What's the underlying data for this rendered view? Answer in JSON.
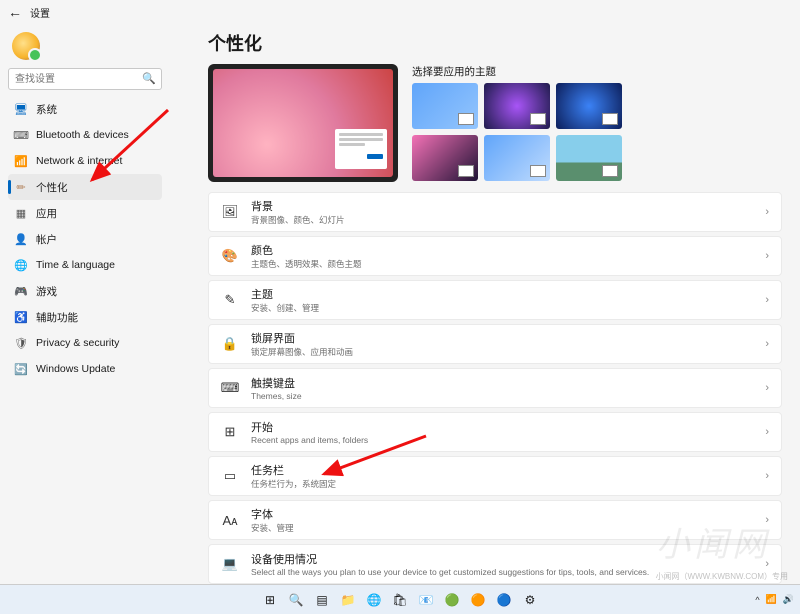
{
  "app": {
    "title": "设置"
  },
  "search": {
    "placeholder": "查找设置"
  },
  "sidebar": [
    {
      "label": "系统",
      "icon": "🖥",
      "color": "#0067c0"
    },
    {
      "label": "Bluetooth & devices",
      "icon": "⌨",
      "color": "#555"
    },
    {
      "label": "Network & internet",
      "icon": "📶",
      "color": "#0ea5e9"
    },
    {
      "label": "个性化",
      "icon": "✏",
      "color": "#b58863",
      "active": true
    },
    {
      "label": "应用",
      "icon": "▦",
      "color": "#555"
    },
    {
      "label": "帐户",
      "icon": "👤",
      "color": "#e11d48"
    },
    {
      "label": "Time & language",
      "icon": "🌐",
      "color": "#0ea5e9"
    },
    {
      "label": "游戏",
      "icon": "🎮",
      "color": "#555"
    },
    {
      "label": "辅助功能",
      "icon": "♿",
      "color": "#0067c0"
    },
    {
      "label": "Privacy & security",
      "icon": "🛡",
      "color": "#555"
    },
    {
      "label": "Windows Update",
      "icon": "🔄",
      "color": "#0ea5e9"
    }
  ],
  "page": {
    "title": "个性化",
    "theme_label": "选择要应用的主题"
  },
  "cards": [
    {
      "icon": "🖼",
      "title": "背景",
      "desc": "背景图像、颜色、幻灯片"
    },
    {
      "icon": "🎨",
      "title": "颜色",
      "desc": "主题色、透明效果、颜色主题"
    },
    {
      "icon": "✎",
      "title": "主题",
      "desc": "安装、创建、管理"
    },
    {
      "icon": "🔒",
      "title": "锁屏界面",
      "desc": "锁定屏幕图像、应用和动画"
    },
    {
      "icon": "⌨",
      "title": "触摸键盘",
      "desc": "Themes, size"
    },
    {
      "icon": "⊞",
      "title": "开始",
      "desc": "Recent apps and items, folders"
    },
    {
      "icon": "▭",
      "title": "任务栏",
      "desc": "任务栏行为，系统固定"
    },
    {
      "icon": "Aᴀ",
      "title": "字体",
      "desc": "安装、管理"
    },
    {
      "icon": "💻",
      "title": "设备使用情况",
      "desc": "Select all the ways you plan to use your device to get customized suggestions for tips, tools, and services."
    }
  ],
  "taskbar": {
    "icons": [
      "⊞",
      "🔍",
      "▤",
      "📁",
      "🌐",
      "🛍",
      "📧",
      "🟢",
      "🟠",
      "🔵",
      "⚙"
    ]
  },
  "watermark": {
    "big": "小闻网",
    "small": "小闻网（WWW.KWBNW.COM）专用"
  }
}
